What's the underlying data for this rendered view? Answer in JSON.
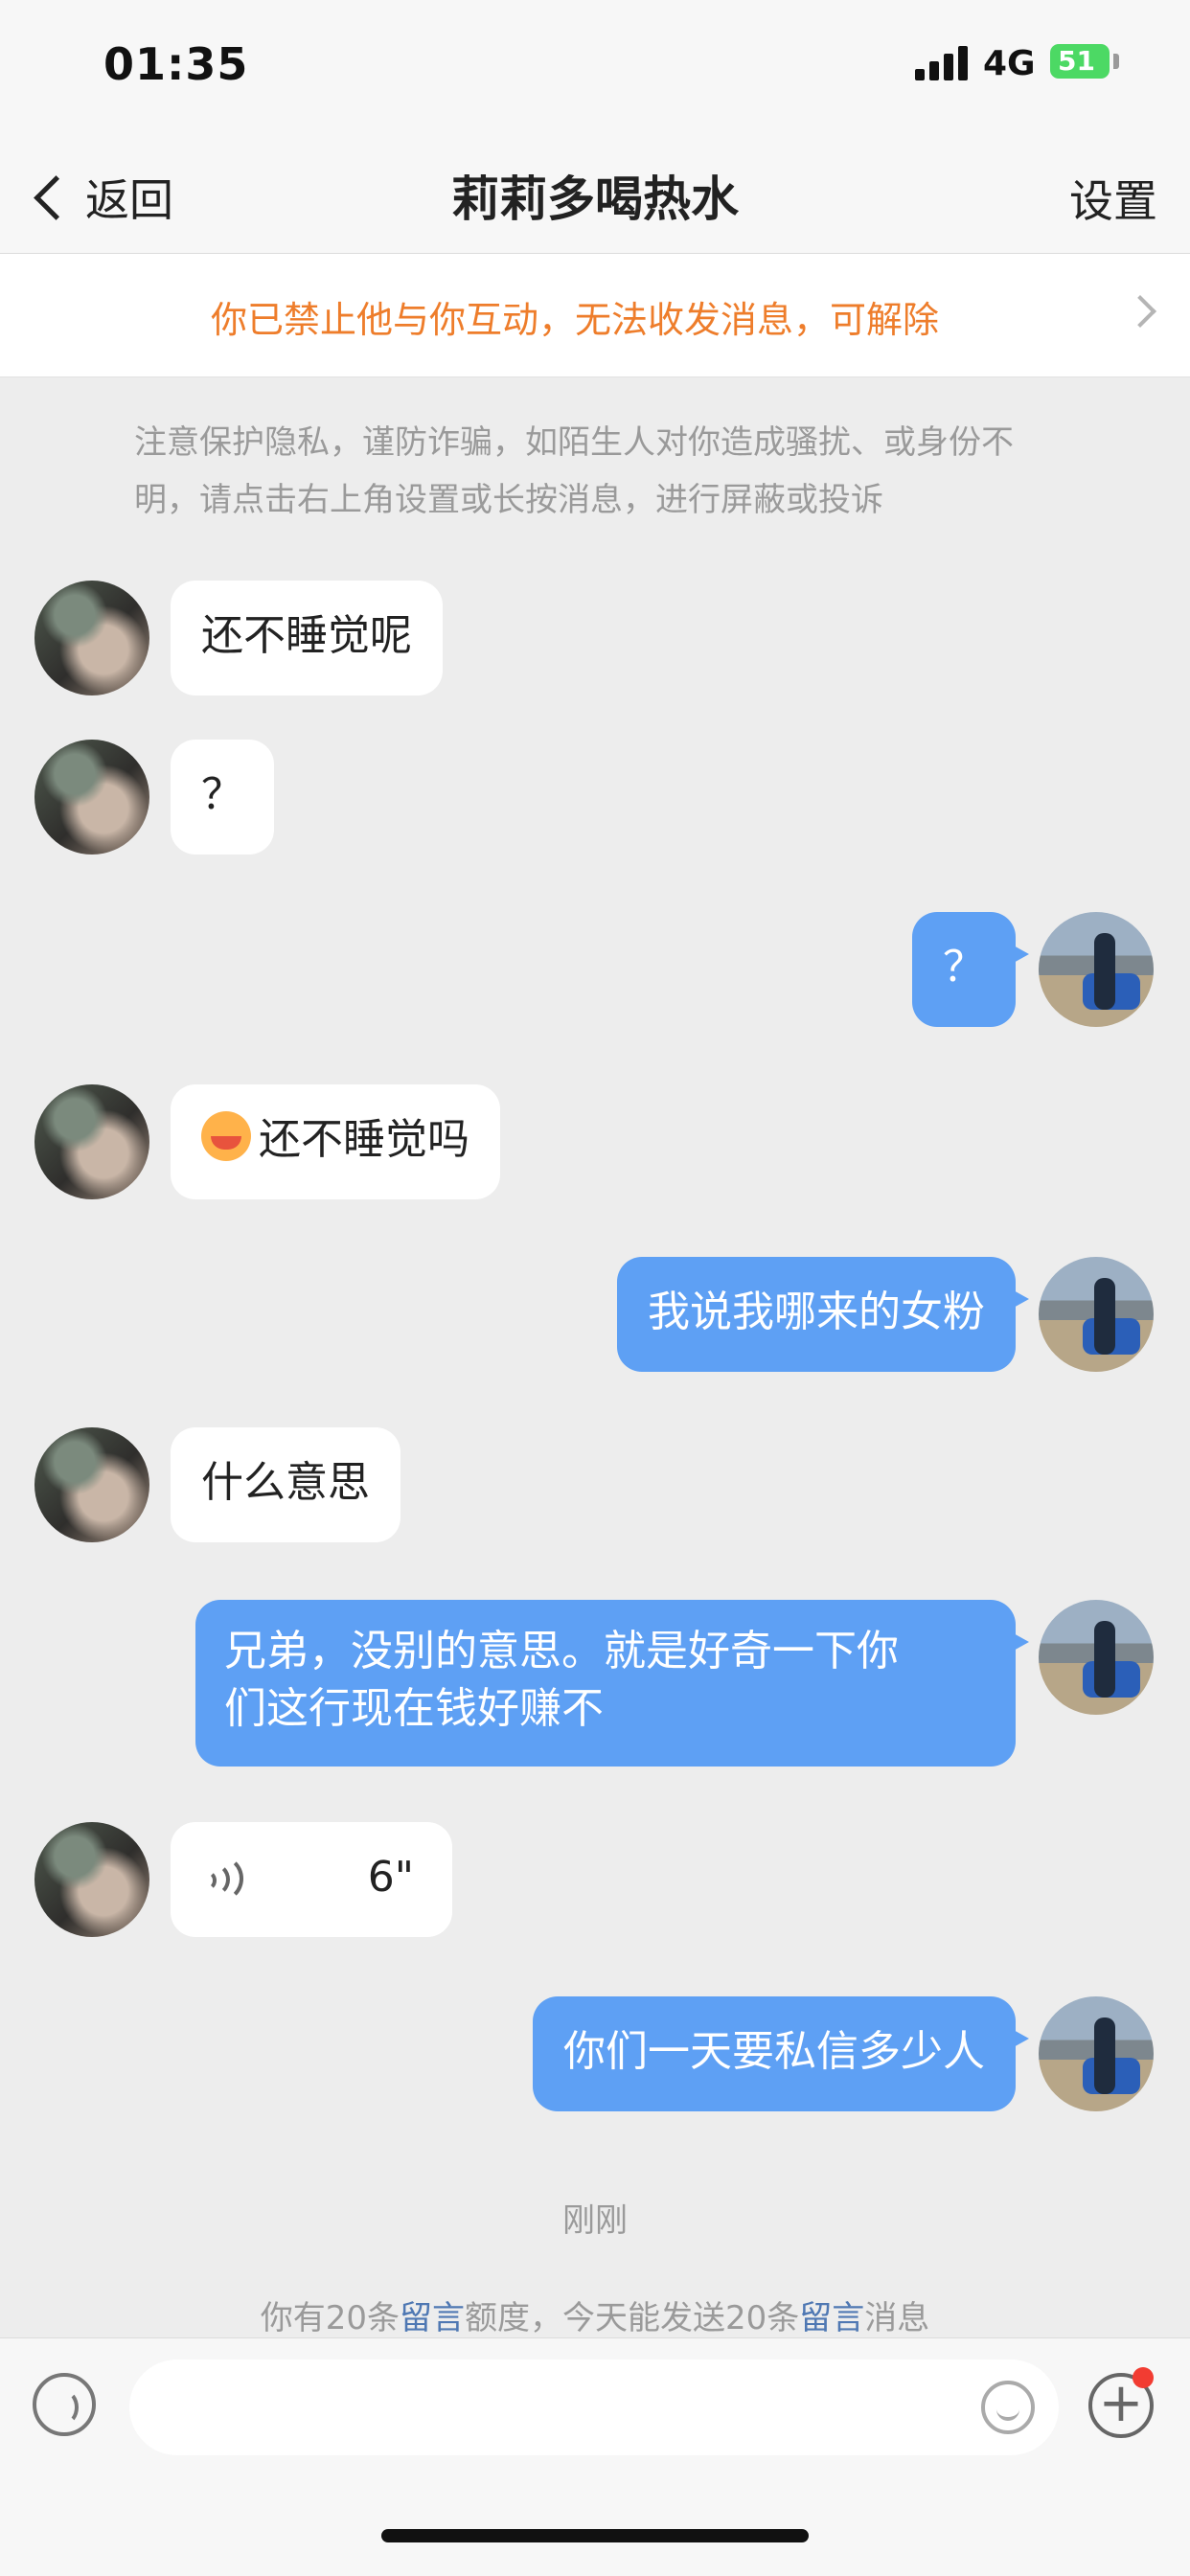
{
  "status_bar": {
    "time": "01:35",
    "network": "4G",
    "battery": "51"
  },
  "header": {
    "back_label": "返回",
    "title": "莉莉多喝热水",
    "settings_label": "设置"
  },
  "banner": {
    "text": "你已禁止他与你互动，无法收发消息，可解除"
  },
  "notice": {
    "text": "注意保护隐私，谨防诈骗，如陌生人对你造成骚扰、或身份不明，请点击右上角设置或长按消息，进行屏蔽或投诉"
  },
  "messages": [
    {
      "side": "left",
      "text": "还不睡觉呢"
    },
    {
      "side": "left",
      "text": "？"
    },
    {
      "side": "right",
      "text": "？"
    },
    {
      "side": "left",
      "text": "还不睡觉吗",
      "emoji": "face-blowing-kiss-emoji"
    },
    {
      "side": "right",
      "text": "我说我哪来的女粉"
    },
    {
      "side": "left",
      "text": "什么意思"
    },
    {
      "side": "right",
      "line1": "兄弟，没别的意思。就是好奇一下你",
      "line2": "们这行现在钱好赚不"
    },
    {
      "side": "left",
      "type": "voice",
      "duration": "6\""
    },
    {
      "side": "right",
      "text": "你们一天要私信多少人"
    }
  ],
  "timestamp": "刚刚",
  "quota": {
    "part1": "你有20条",
    "link1": "留言",
    "part2": "额度，今天能发送20条",
    "link2": "留言",
    "part3": "消息"
  },
  "input_bar": {
    "placeholder": ""
  },
  "colors": {
    "sent_bubble": "#5ea0f4",
    "banner_text": "#ee7d2b",
    "link": "#4f78b3",
    "badge": "#f23c32"
  }
}
